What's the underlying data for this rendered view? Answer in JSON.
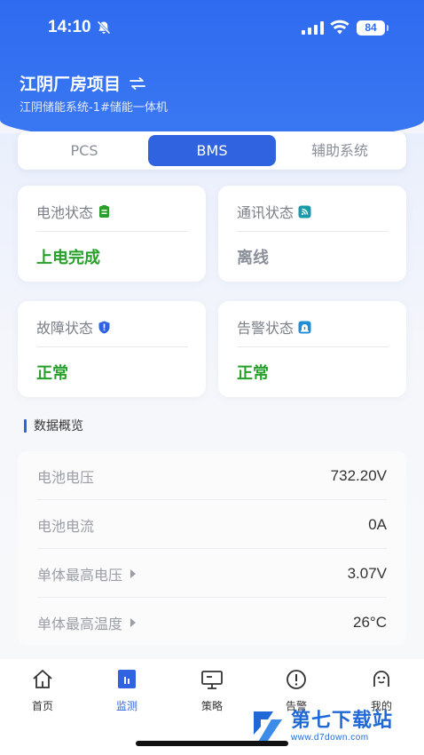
{
  "status_bar": {
    "time": "14:10",
    "battery": "84"
  },
  "header": {
    "title": "江阴厂房项目",
    "subtitle": "江阴储能系统-1#储能一体机"
  },
  "tabs": [
    {
      "label": "PCS"
    },
    {
      "label": "BMS",
      "active": true
    },
    {
      "label": "辅助系统"
    }
  ],
  "cards": [
    {
      "label": "电池状态",
      "value": "上电完成",
      "icon": "battery-icon",
      "value_color": "#27a02a"
    },
    {
      "label": "通讯状态",
      "value": "离线",
      "icon": "signal-icon",
      "value_color": "#8a8f99"
    },
    {
      "label": "故障状态",
      "value": "正常",
      "icon": "shield-icon",
      "value_color": "#27a02a"
    },
    {
      "label": "告警状态",
      "value": "正常",
      "icon": "alarm-icon",
      "value_color": "#27a02a"
    }
  ],
  "section": {
    "title": "数据概览"
  },
  "data_rows": [
    {
      "label": "电池电压",
      "value": "732.20V",
      "expandable": false
    },
    {
      "label": "电池电流",
      "value": "0A",
      "expandable": false
    },
    {
      "label": "单体最高电压",
      "value": "3.07V",
      "expandable": true
    },
    {
      "label": "单体最高温度",
      "value": "26°C",
      "expandable": true
    }
  ],
  "nav": [
    {
      "label": "首页",
      "icon": "home-icon"
    },
    {
      "label": "监测",
      "icon": "monitor-icon",
      "active": true
    },
    {
      "label": "策略",
      "icon": "strategy-icon"
    },
    {
      "label": "告警",
      "icon": "alert-icon"
    },
    {
      "label": "我的",
      "icon": "profile-icon"
    }
  ],
  "watermark": {
    "main": "第七下载站",
    "sub": "www.d7down.com"
  },
  "colors": {
    "primary": "#2f63e0",
    "ok": "#27a02a",
    "muted": "#8a8f99"
  }
}
